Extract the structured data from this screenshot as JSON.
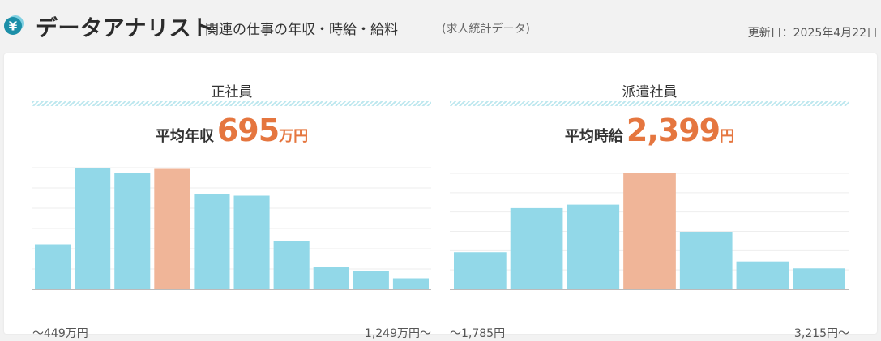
{
  "header": {
    "icon": "yen-icon",
    "title_main": "データアナリスト",
    "title_sub": "関連の仕事の年収・時給・給料",
    "title_note": "(求人統計データ)",
    "updated": "更新日：2025年4月22日"
  },
  "colors": {
    "bar": "#92d8e8",
    "bar_highlight": "#f0b598",
    "accent": "#e5763f",
    "icon_bg": "#1c8fa8"
  },
  "panels": [
    {
      "title": "正社員",
      "avg_label": "平均年収",
      "avg_value": "695",
      "avg_unit": "万円",
      "min_label": "～449万円",
      "max_label": "1,249万円～"
    },
    {
      "title": "派遣社員",
      "avg_label": "平均時給",
      "avg_value": "2,399",
      "avg_unit": "円",
      "min_label": "～1,785円",
      "max_label": "3,215円～"
    }
  ],
  "chart_data": [
    {
      "type": "bar",
      "categories": [
        "～449万円",
        "",
        "",
        "",
        "",
        "",
        "",
        "",
        "",
        "1,249万円～"
      ],
      "values": [
        37,
        100,
        96,
        99,
        78,
        77,
        40,
        18,
        15,
        9
      ],
      "highlight_index": 3,
      "ylim": [
        0,
        100
      ],
      "grid": true
    },
    {
      "type": "bar",
      "categories": [
        "～1,785円",
        "",
        "",
        "",
        "",
        "",
        "3,215円～"
      ],
      "values": [
        32,
        70,
        73,
        100,
        49,
        24,
        18
      ],
      "highlight_index": 3,
      "ylim": [
        0,
        100
      ],
      "grid": true
    }
  ]
}
